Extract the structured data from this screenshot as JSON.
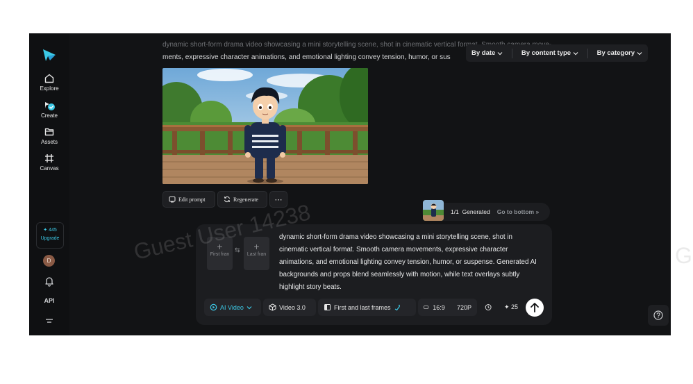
{
  "nav": {
    "items": [
      {
        "label": "Explore",
        "icon": "home-icon"
      },
      {
        "label": "Create",
        "icon": "create-icon"
      },
      {
        "label": "Assets",
        "icon": "folder-icon"
      },
      {
        "label": "Canvas",
        "icon": "canvas-icon"
      }
    ],
    "credits": "445",
    "upgrade": "Upgrade",
    "avatar_initial": "D",
    "api_label": "API"
  },
  "history": {
    "prompt_line1": "dynamic short-form drama video showcasing a mini storytelling scene, shot in cinematic vertical format. Smooth camera move-",
    "prompt_line2": "ments, expressive character animations, and emotional lighting convey tension, humor, or sus",
    "actions": {
      "edit": "Edit prompt",
      "regenerate": "Regenerate",
      "more": "⋯"
    }
  },
  "filters": {
    "by_date": "By date",
    "by_content_type": "By content type",
    "by_category": "By category"
  },
  "status": {
    "count": "1/1",
    "generated": "Generated",
    "goto": "Go to bottom"
  },
  "composer": {
    "first_frame": "First fran",
    "last_frame": "Last fran",
    "prompt": "dynamic short-form drama video showcasing a mini storytelling scene, shot in cinematic vertical format. Smooth camera movements, expressive character animations, and emotional lighting convey tension, humor, or suspense. Generated AI backgrounds and props blend seamlessly with motion, while text overlays subtly highlight story beats.",
    "mode": "AI Video",
    "model": "Video 3.0",
    "frames_mode": "First and last frames",
    "ratio": "16:9",
    "resolution": "720P",
    "duration": "",
    "cost": "25"
  },
  "watermark": {
    "text": "Guest User 14238",
    "edge": "G"
  },
  "colors": {
    "accent": "#3cc9e6",
    "background": "#121315",
    "panel": "#1c1d20"
  }
}
